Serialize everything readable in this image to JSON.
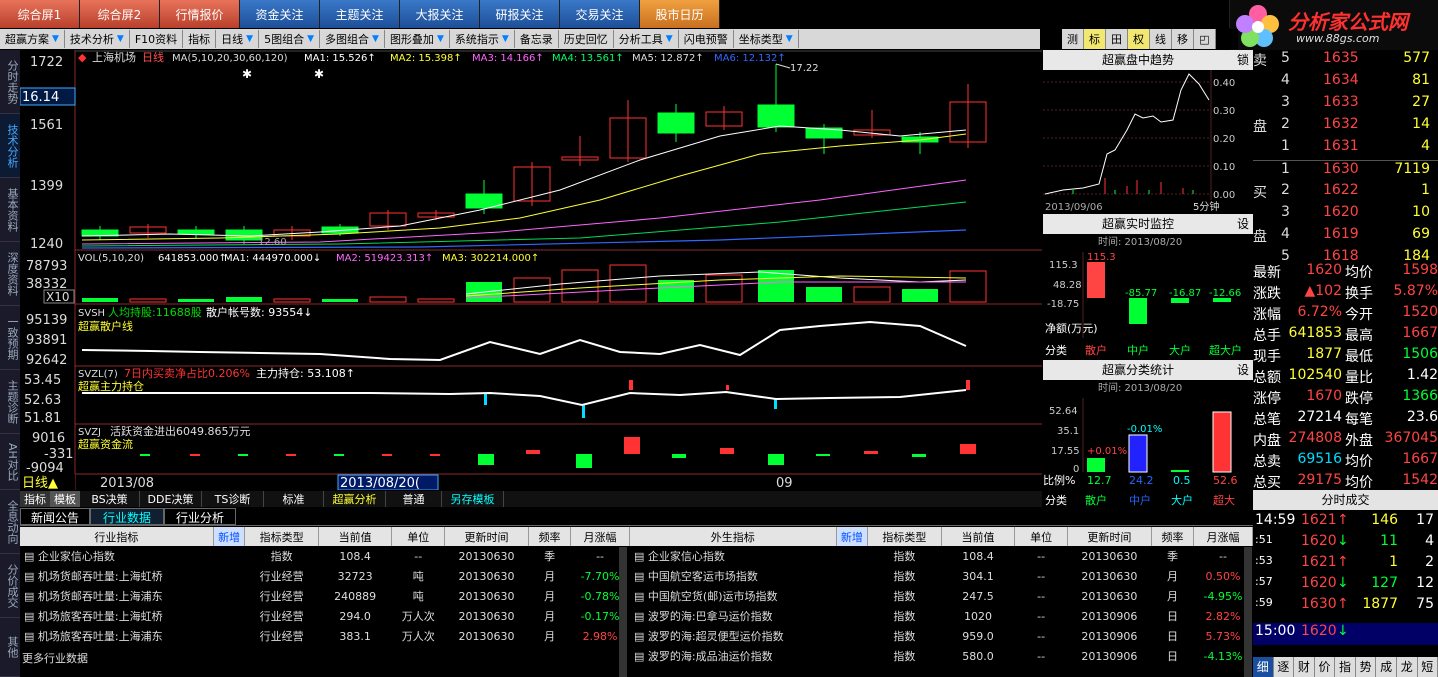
{
  "top_tabs": [
    "综合屏1",
    "综合屏2",
    "行情报价",
    "资金关注",
    "主题关注",
    "大报关注",
    "研报关注",
    "交易关注",
    "股市日历"
  ],
  "logo": {
    "title": "分析家公式网",
    "url": "www.88gs.com"
  },
  "toolbar": [
    "超赢方案",
    "技术分析",
    "F10资料",
    "指标",
    "日线",
    "5图组合",
    "多图组合",
    "图形叠加",
    "系统指示",
    "备忘录",
    "历史回忆",
    "分析工具",
    "闪电预警",
    "坐标类型"
  ],
  "toolbar_right": [
    "测",
    "标",
    "田",
    "权",
    "线",
    "移",
    "◰"
  ],
  "left_tabs": [
    "分时走势",
    "技术分析",
    "基本资料",
    "深度资料",
    "一致预期",
    "主题诊断",
    "AH对比",
    "全息动向",
    "分价成交",
    "其他"
  ],
  "chart": {
    "stock": "上海机场",
    "period": "日线",
    "ma_header": "MA(5,10,20,30,60,120)",
    "ma1": "MA1: 15.526↑",
    "ma2": "MA2: 15.398↑",
    "ma3": "MA3: 14.166↑",
    "ma4": "MA4: 13.561↑",
    "ma5": "MA5: 12.872↑",
    "ma6": "MA6: 12.132↑",
    "price_axis": [
      "1722",
      "16.14",
      "1561",
      "1399",
      "1240"
    ],
    "high_label": "17.22",
    "low_label": "12.60",
    "vol_header": "VOL(5,10,20)",
    "vol_val": "641853.000↑",
    "vol_ma1": "MA1: 444970.000↓",
    "vol_ma2": "MA2: 519423.313↑",
    "vol_ma3": "MA3: 302214.000↑",
    "vol_axis": [
      "78793",
      "38332",
      "X10"
    ],
    "svsh_header": "SVSH",
    "svsh_holders": "人均持股:11688股",
    "svsh_accounts": "散户帐号数: 93554↓",
    "svsh_name": "超赢散户线",
    "svsh_axis": [
      "95139",
      "93891",
      "92642"
    ],
    "svzl_header": "SVZL(7)",
    "svzl_ratio": "7日内买卖净占比0.206%",
    "svzl_hold": "主力持仓: 53.108↑",
    "svzl_name": "超赢主力持仓",
    "svzl_axis": [
      "53.45",
      "52.63",
      "51.81"
    ],
    "svzj_header": "SVZJ",
    "svzj_flow": "活跃资金进出6049.865万元",
    "svzj_name": "超赢资金流",
    "svzj_axis": [
      "9016",
      "-331",
      "-9094"
    ],
    "date_left": "2013/08",
    "date_cursor": "2013/08/20(",
    "date_right": "09",
    "period_btn": "日线▲"
  },
  "template_tabs": [
    "指标",
    "模板",
    "BS决策",
    "DDE决策",
    "TS诊断",
    "标准",
    "超赢分析",
    "普通",
    "另存模板"
  ],
  "right_panels": {
    "trend_title": "超赢盘中趋势",
    "trend_btn": "锁",
    "trend_axis": [
      "0.40",
      "0.30",
      "0.20",
      "0.10",
      "0.00"
    ],
    "trend_date": "2013/09/06",
    "trend_period": "5分钟",
    "monitor_title": "超赢实时监控",
    "monitor_btn": "设",
    "monitor_time": "时间: 2013/08/20",
    "monitor_axis": [
      "115.3",
      "48.28",
      "-18.75",
      "-85.77"
    ],
    "monitor_vals": [
      "115.3",
      "-85.77",
      "-16.87",
      "-12.66"
    ],
    "monitor_unit": "净额(万元)",
    "monitor_cats": [
      "分类",
      "散户",
      "中户",
      "大户",
      "超大户"
    ],
    "stat_title": "超赢分类统计",
    "stat_btn": "设",
    "stat_time": "时间: 2013/08/20",
    "stat_axis": [
      "52.64",
      "35.1",
      "17.55",
      "0"
    ],
    "stat_vals": [
      "+0.01%",
      "-0.01%"
    ],
    "stat_ratio_label": "比例%",
    "stat_ratios": [
      "12.7",
      "24.2",
      "0.5",
      "52.6"
    ],
    "stat_cats": [
      "分类",
      "散户",
      "中户",
      "大户",
      "超大"
    ]
  },
  "order_book": [
    {
      "side": "卖",
      "lvl": "5",
      "price": "1635",
      "vol": "577"
    },
    {
      "side": "",
      "lvl": "4",
      "price": "1634",
      "vol": "81"
    },
    {
      "side": "",
      "lvl": "3",
      "price": "1633",
      "vol": "27"
    },
    {
      "side": "盘",
      "lvl": "2",
      "price": "1632",
      "vol": "14"
    },
    {
      "side": "",
      "lvl": "1",
      "price": "1631",
      "vol": "4"
    },
    {
      "side": "",
      "lvl": "1",
      "price": "1630",
      "vol": "7119"
    },
    {
      "side": "买",
      "lvl": "2",
      "price": "1622",
      "vol": "1"
    },
    {
      "side": "",
      "lvl": "3",
      "price": "1620",
      "vol": "10"
    },
    {
      "side": "盘",
      "lvl": "4",
      "price": "1619",
      "vol": "69"
    },
    {
      "side": "",
      "lvl": "5",
      "price": "1618",
      "vol": "184"
    }
  ],
  "quote": [
    {
      "l1": "最新",
      "v1": "1620",
      "l2": "均价",
      "v2": "1598"
    },
    {
      "l1": "涨跌",
      "v1": "▲102",
      "l2": "换手",
      "v2": "5.87%"
    },
    {
      "l1": "涨幅",
      "v1": "6.72%",
      "l2": "今开",
      "v2": "1520"
    },
    {
      "l1": "总手",
      "v1": "641853",
      "l2": "最高",
      "v2": "1667"
    },
    {
      "l1": "现手",
      "v1": "1877",
      "l2": "最低",
      "v2": "1506"
    },
    {
      "l1": "总额",
      "v1": "102540",
      "l2": "量比",
      "v2": "1.42"
    },
    {
      "l1": "涨停",
      "v1": "1670",
      "l2": "跌停",
      "v2": "1366"
    },
    {
      "l1": "总笔",
      "v1": "27214",
      "l2": "每笔",
      "v2": "23.6"
    },
    {
      "l1": "内盘",
      "v1": "274808",
      "l2": "外盘",
      "v2": "367045"
    },
    {
      "l1": "总卖",
      "v1": "69516",
      "l2": "均价",
      "v2": "1667"
    },
    {
      "l1": "总买",
      "v1": "29175",
      "l2": "均价",
      "v2": "1542"
    }
  ],
  "trades_title": "分时成交",
  "trades": [
    {
      "t": "14:59",
      "p": "1621",
      "a": "↑",
      "v": "146",
      "n": "17"
    },
    {
      "t": ":51",
      "p": "1620",
      "a": "↓",
      "v": "11",
      "n": "4"
    },
    {
      "t": ":53",
      "p": "1621",
      "a": "↑",
      "v": "1",
      "n": "2"
    },
    {
      "t": ":57",
      "p": "1620",
      "a": "↓",
      "v": "127",
      "n": "12"
    },
    {
      "t": ":59",
      "p": "1630",
      "a": "↑",
      "v": "1877",
      "n": "75"
    },
    {
      "t": "15:00",
      "p": "1620",
      "a": "↓",
      "v": "",
      "n": ""
    }
  ],
  "trades_tabs": [
    "细",
    "逐",
    "财",
    "价",
    "指",
    "势",
    "成",
    "龙",
    "短"
  ],
  "bottom_tabs": [
    "新闻公告",
    "行业数据",
    "行业分析"
  ],
  "industry": {
    "headers": [
      "行业指标",
      "新增",
      "指标类型",
      "当前值",
      "单位",
      "更新时间",
      "频率",
      "月涨幅"
    ],
    "rows": [
      [
        "企业家信心指数",
        "指数",
        "108.4",
        "--",
        "20130630",
        "季",
        "--"
      ],
      [
        "机场货邮吞吐量:上海虹桥",
        "行业经营",
        "32723",
        "吨",
        "20130630",
        "月",
        "-7.70%"
      ],
      [
        "机场货邮吞吐量:上海浦东",
        "行业经营",
        "240889",
        "吨",
        "20130630",
        "月",
        "-0.78%"
      ],
      [
        "机场旅客吞吐量:上海虹桥",
        "行业经营",
        "294.0",
        "万人次",
        "20130630",
        "月",
        "-0.17%"
      ],
      [
        "机场旅客吞吐量:上海浦东",
        "行业经营",
        "383.1",
        "万人次",
        "20130630",
        "月",
        "2.98%"
      ]
    ],
    "more": "更多行业数据"
  },
  "external": {
    "headers": [
      "外生指标",
      "新增",
      "指标类型",
      "当前值",
      "单位",
      "更新时间",
      "频率",
      "月涨幅"
    ],
    "rows": [
      [
        "企业家信心指数",
        "指数",
        "108.4",
        "--",
        "20130630",
        "季",
        "--"
      ],
      [
        "中国航空客运市场指数",
        "指数",
        "304.1",
        "--",
        "20130630",
        "月",
        "0.50%"
      ],
      [
        "中国航空货(邮)运市场指数",
        "指数",
        "247.5",
        "--",
        "20130630",
        "月",
        "-4.95%"
      ],
      [
        "波罗的海:巴拿马运价指数",
        "指数",
        "1020",
        "--",
        "20130906",
        "日",
        "2.82%"
      ],
      [
        "波罗的海:超灵便型运价指数",
        "指数",
        "959.0",
        "--",
        "20130906",
        "日",
        "5.73%"
      ],
      [
        "波罗的海:成品油运价指数",
        "指数",
        "580.0",
        "--",
        "20130906",
        "日",
        "-4.13%"
      ]
    ]
  },
  "colors": {
    "up": "#ff3333",
    "down": "#00ee00",
    "accent": "#3a78c8"
  }
}
